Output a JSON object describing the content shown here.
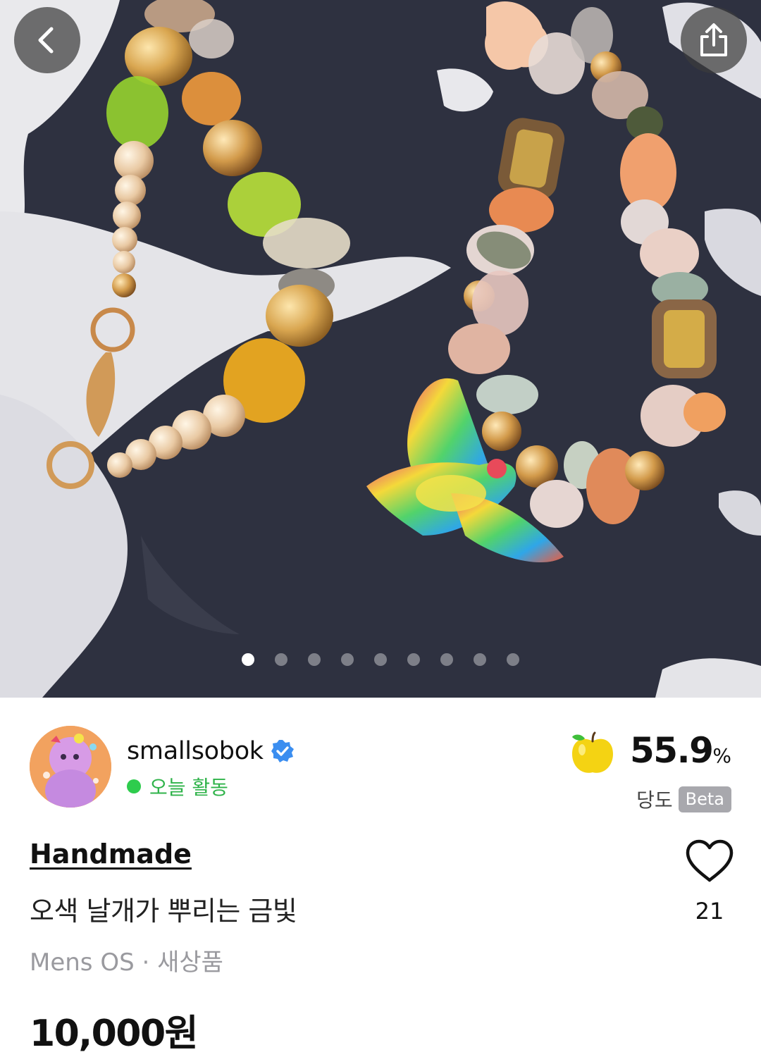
{
  "header": {
    "back_icon": "chevron-left-icon",
    "share_icon": "share-icon"
  },
  "gallery": {
    "total_images": 9,
    "active_index": 0
  },
  "seller": {
    "name": "smallsobok",
    "verified": true,
    "activity": "오늘 활동",
    "activity_color": "#2fb34a",
    "score_value": "55.9",
    "score_unit": "%",
    "score_label": "당도",
    "score_badge": "Beta"
  },
  "product": {
    "brand": "Handmade",
    "title": "오색 날개가 뿌리는 금빛",
    "meta": "Mens OS · 새상품",
    "price": "10,000원",
    "like_count": "21"
  }
}
